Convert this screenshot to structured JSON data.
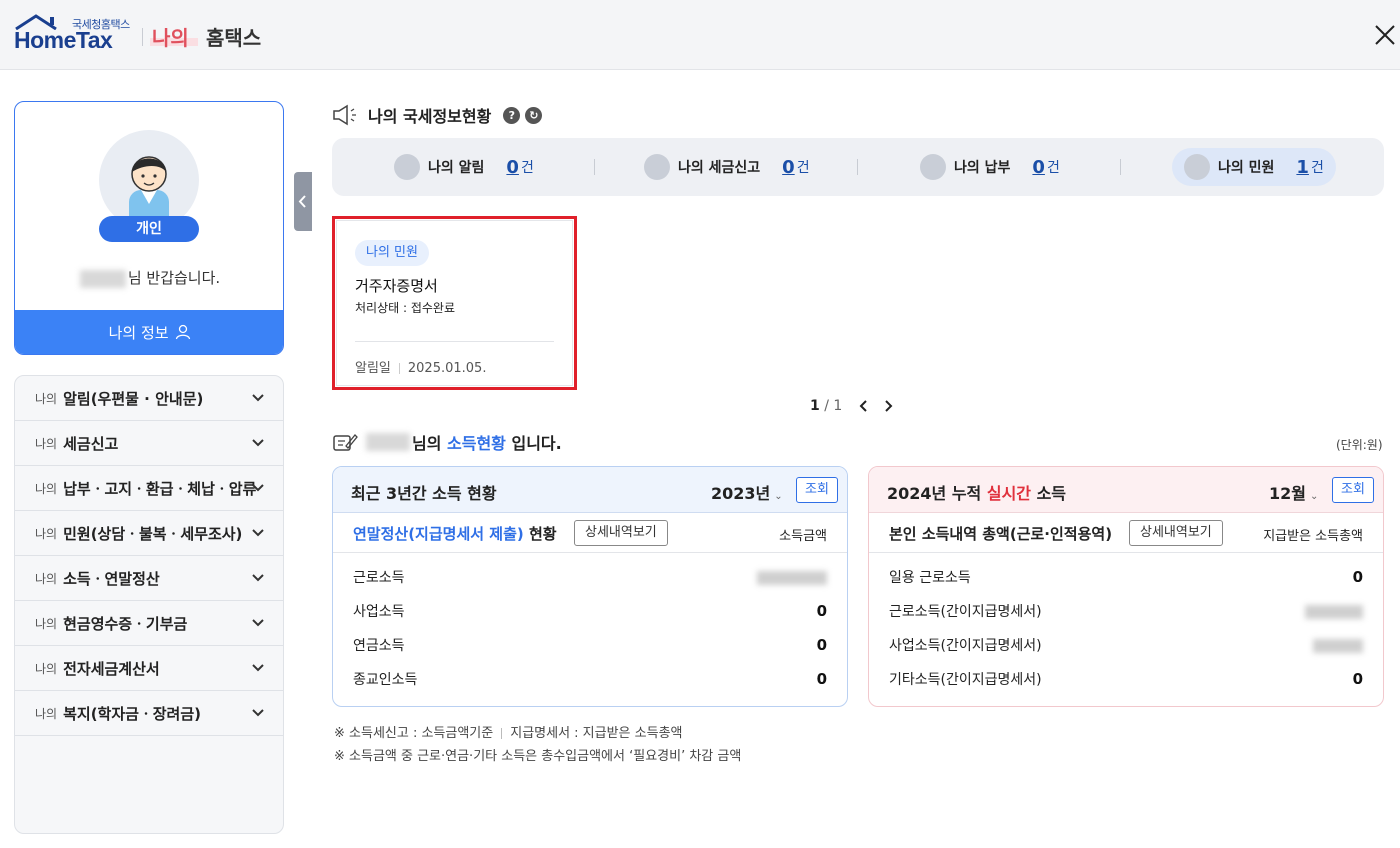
{
  "header": {
    "logo_sub": "국세청홈택스",
    "logo_main": "HomeTax",
    "my_label": "나의",
    "hometax_label": "홈택스"
  },
  "profile": {
    "badge": "개인",
    "greeting_suffix": "님 반갑습니다.",
    "myinfo_button": "나의 정보"
  },
  "menu": {
    "prefix": "나의",
    "items": [
      {
        "label": "알림(우편물 · 안내문)"
      },
      {
        "label": "세금신고"
      },
      {
        "label": "납부ㆍ고지ㆍ환급ㆍ체납ㆍ압류"
      },
      {
        "label": "민원(상담ㆍ불복ㆍ세무조사)"
      },
      {
        "label": "소득ㆍ연말정산"
      },
      {
        "label": "현금영수증ㆍ기부금"
      },
      {
        "label": "전자세금계산서"
      },
      {
        "label": "복지(학자금ㆍ장려금)"
      }
    ]
  },
  "status": {
    "title": "나의 국세정보현황",
    "items": [
      {
        "label": "나의 알림",
        "count": "0",
        "unit": "건"
      },
      {
        "label": "나의 세금신고",
        "count": "0",
        "unit": "건"
      },
      {
        "label": "나의 납부",
        "count": "0",
        "unit": "건"
      },
      {
        "label": "나의 민원",
        "count": "1",
        "unit": "건"
      }
    ]
  },
  "notice": {
    "tag": "나의 민원",
    "title": "거주자증명서",
    "status": "처리상태 : 접수완료",
    "date_label": "알림일",
    "date": "2025.01.05."
  },
  "pager": {
    "current": "1",
    "sep": " / ",
    "total": "1"
  },
  "income": {
    "title_mid": "님의 ",
    "title_hl": "소득현황",
    "title_end": " 입니다.",
    "unit_note": "(단위:원)",
    "left": {
      "title": "최근 3년간 소득 현황",
      "year": "2023년",
      "query_btn": "조회",
      "sub_title_hl": "연말정산(지급명세서 제출)",
      "sub_title_end": " 현황",
      "detail_btn": "상세내역보기",
      "right_label": "소득금액",
      "rows": [
        {
          "label": "근로소득",
          "value": ""
        },
        {
          "label": "사업소득",
          "value": "0"
        },
        {
          "label": "연금소득",
          "value": "0"
        },
        {
          "label": "종교인소득",
          "value": "0"
        }
      ]
    },
    "right": {
      "title_a": "2024년 누적 ",
      "title_red": "실시간",
      "title_b": " 소득",
      "month": "12월",
      "query_btn": "조회",
      "sub_title": "본인 소득내역 총액(근로·인적용역)",
      "detail_btn": "상세내역보기",
      "right_label": "지급받은 소득총액",
      "rows": [
        {
          "label": "일용 근로소득",
          "value": "0"
        },
        {
          "label": "근로소득(간이지급명세서)",
          "value": ""
        },
        {
          "label": "사업소득(간이지급명세서)",
          "value": ""
        },
        {
          "label": "기타소득(간이지급명세서)",
          "value": "0"
        }
      ]
    }
  },
  "footnotes": {
    "line1_a": "※ 소득세신고 : 소득금액기준",
    "line1_b": "지급명세서 : 지급받은 소득총액",
    "line2": "※ 소득금액 중 근로·연금·기타 소득은 총수입금액에서 ‘필요경비’ 차감 금액"
  },
  "colors": {
    "accent": "#2f6fe6",
    "highlight_border": "#e0202a",
    "my_red": "#e0505d"
  }
}
